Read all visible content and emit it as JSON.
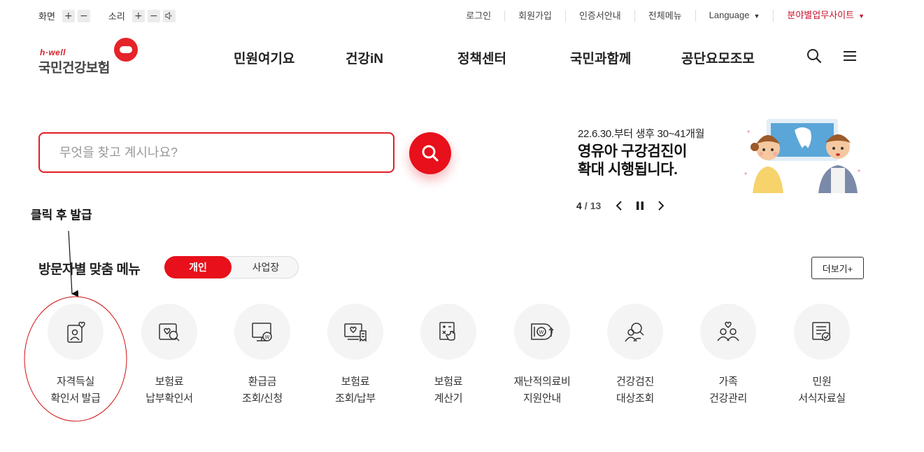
{
  "utility": {
    "screen_label": "화면",
    "sound_label": "소리",
    "plus": "+",
    "minus": "−",
    "links": [
      "로그인",
      "회원가입",
      "인증서안내",
      "전체메뉴"
    ],
    "language": "Language",
    "field_site": "분야별업무사이트"
  },
  "header": {
    "logo_top": "h·well",
    "logo_name": "국민건강보험",
    "nav": [
      "민원여기요",
      "건강iN",
      "정책센터",
      "국민과함께",
      "공단요모조모"
    ]
  },
  "search": {
    "placeholder": "무엇을 찾고 계시나요?",
    "value": ""
  },
  "banner": {
    "subtitle": "22.6.30.부터 생후 30~41개월",
    "title_line1": "영유아 구강검진이",
    "title_line2": "확대 시행됩니다.",
    "current": "4",
    "separator": "/",
    "total": "13"
  },
  "annotation": {
    "text": "클릭 후 발급"
  },
  "custom_menu": {
    "title": "방문자별 맞춤 메뉴",
    "toggle_on": "개인",
    "toggle_off": "사업장",
    "more": "더보기+",
    "items": [
      {
        "line1": "자격득실",
        "line2": "확인서 발급",
        "icon": "qualification-certificate-icon"
      },
      {
        "line1": "보험료",
        "line2": "납부확인서",
        "icon": "payment-confirmation-icon"
      },
      {
        "line1": "환급금",
        "line2": "조회/신청",
        "icon": "refund-icon"
      },
      {
        "line1": "보험료",
        "line2": "조회/납부",
        "icon": "premium-inquiry-icon"
      },
      {
        "line1": "보험료",
        "line2": "계산기",
        "icon": "calculator-icon"
      },
      {
        "line1": "재난적의료비",
        "line2": "지원안내",
        "icon": "medical-expense-support-icon"
      },
      {
        "line1": "건강검진",
        "line2": "대상조회",
        "icon": "health-checkup-icon"
      },
      {
        "line1": "가족",
        "line2": "건강관리",
        "icon": "family-health-icon"
      },
      {
        "line1": "민원",
        "line2": "서식자료실",
        "icon": "forms-library-icon"
      }
    ]
  },
  "colors": {
    "brand_red": "#e8101a",
    "annotation_red": "#d01010"
  }
}
